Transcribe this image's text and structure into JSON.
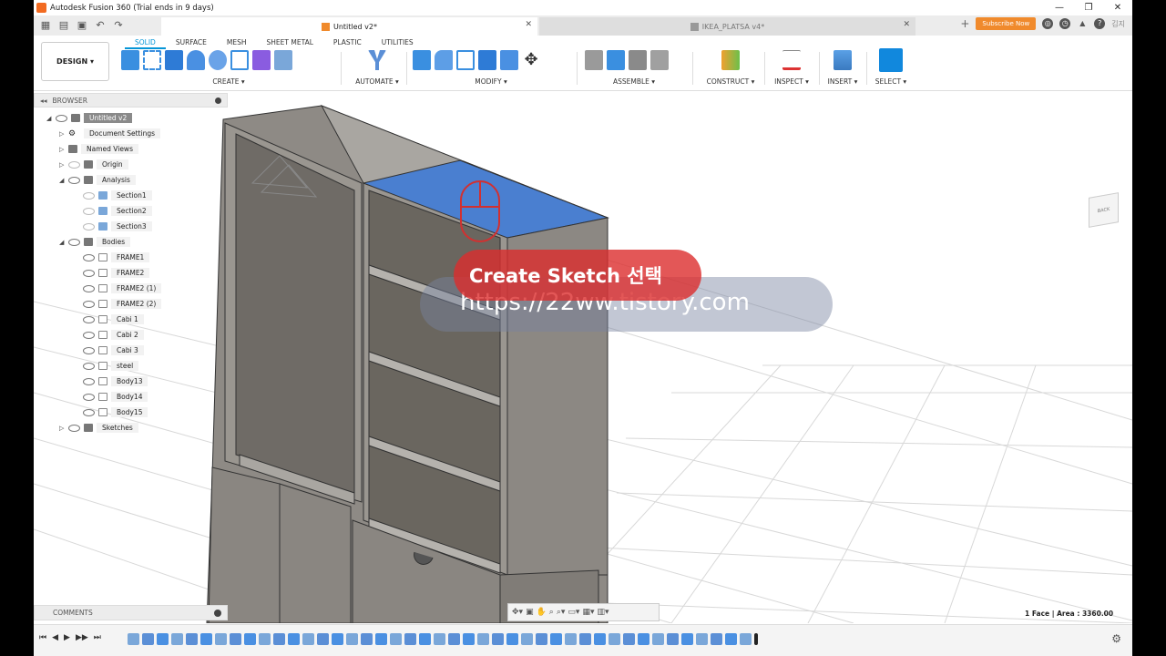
{
  "window": {
    "title": "Autodesk Fusion 360 (Trial ends in 9 days)",
    "controls": [
      "—",
      "❐",
      "✕"
    ]
  },
  "tabs": {
    "active": "Untitled v2*",
    "inactive": "IKEA_PLATSA v4*",
    "subscribe": "Subscribe Now",
    "user": "김지"
  },
  "workspace": {
    "design": "DESIGN ▾",
    "subtabs": [
      "SOLID",
      "SURFACE",
      "MESH",
      "SHEET METAL",
      "PLASTIC",
      "UTILITIES"
    ]
  },
  "groups": {
    "create": "CREATE ▾",
    "automate": "AUTOMATE ▾",
    "modify": "MODIFY ▾",
    "assemble": "ASSEMBLE ▾",
    "construct": "CONSTRUCT ▾",
    "inspect": "INSPECT ▾",
    "insert": "INSERT ▾",
    "select": "SELECT ▾"
  },
  "browser": {
    "title": "BROWSER",
    "root": "Untitled v2",
    "items": {
      "docset": "Document Settings",
      "views": "Named Views",
      "origin": "Origin",
      "analysis": "Analysis",
      "s1": "Section1",
      "s2": "Section2",
      "s3": "Section3",
      "bodies": "Bodies",
      "f1": "FRAME1",
      "f2": "FRAME2",
      "f21": "FRAME2 (1)",
      "f22": "FRAME2 (2)",
      "c1": "Cabi 1",
      "c2": "Cabi 2",
      "c3": "Cabi 3",
      "steel": "steel",
      "b13": "Body13",
      "b14": "Body14",
      "b15": "Body15",
      "sketches": "Sketches"
    }
  },
  "comments": "COMMENTS",
  "overlay": {
    "caption": "Create Sketch 선택",
    "url": "https://22ww.tistory.com"
  },
  "status": "1 Face | Area : 3360.00",
  "colors": {
    "accent": "#0696d7",
    "selected_face": "#4a7fd0",
    "cabinet": "#8e8a85"
  }
}
